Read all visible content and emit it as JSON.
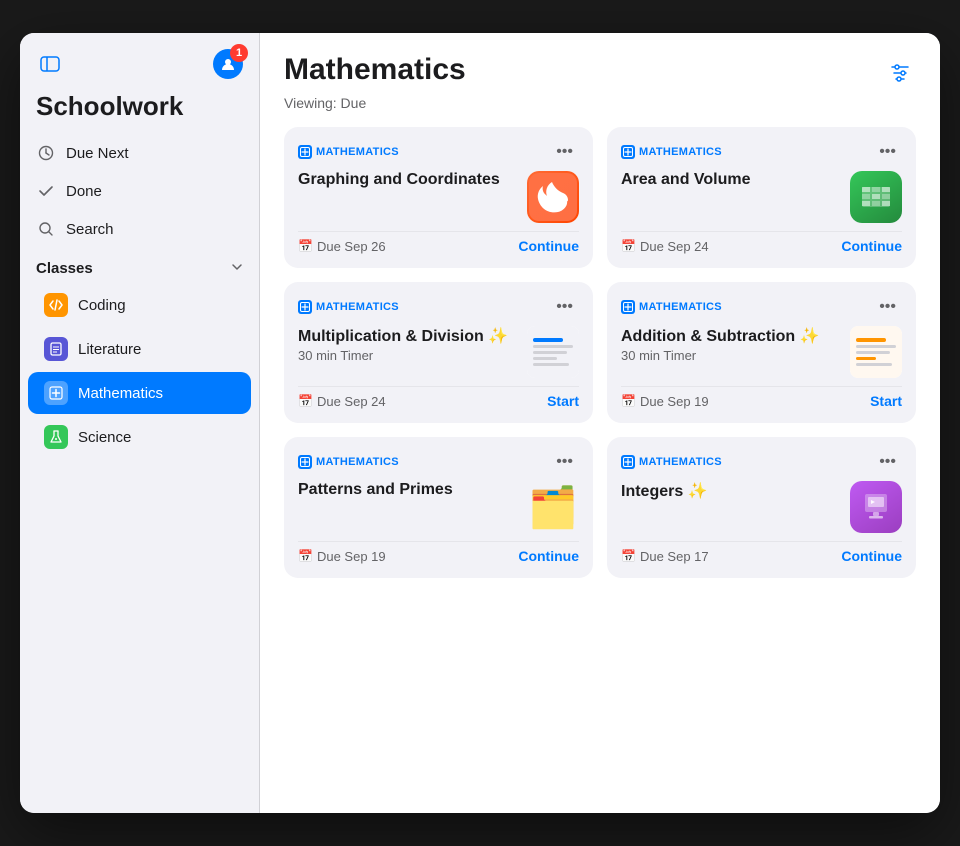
{
  "sidebar": {
    "toggle_label": "⊞",
    "profile_label": "👤",
    "notification_count": "1",
    "app_title": "Schoolwork",
    "nav_items": [
      {
        "id": "due-next",
        "icon": "🕐",
        "label": "Due Next"
      },
      {
        "id": "done",
        "icon": "✓",
        "label": "Done"
      },
      {
        "id": "search",
        "icon": "🔍",
        "label": "Search"
      }
    ],
    "classes_section": {
      "title": "Classes",
      "items": [
        {
          "id": "coding",
          "label": "Coding",
          "color": "coding",
          "icon": "■"
        },
        {
          "id": "literature",
          "label": "Literature",
          "color": "literature",
          "icon": "■"
        },
        {
          "id": "mathematics",
          "label": "Mathematics",
          "color": "mathematics",
          "icon": "■",
          "active": true
        },
        {
          "id": "science",
          "label": "Science",
          "color": "science",
          "icon": "✿"
        }
      ]
    }
  },
  "main": {
    "page_title": "Mathematics",
    "viewing_label": "Viewing: Due",
    "filter_icon": "≡",
    "cards": [
      {
        "id": "graphing",
        "subject": "MATHEMATICS",
        "title": "Graphing and Coordinates",
        "subtitle": "",
        "app_type": "swift",
        "due": "Due Sep 26",
        "action": "Continue"
      },
      {
        "id": "area-volume",
        "subject": "MATHEMATICS",
        "title": "Area and Volume",
        "subtitle": "",
        "app_type": "numbers",
        "due": "Due Sep 24",
        "action": "Continue"
      },
      {
        "id": "multiplication",
        "subject": "MATHEMATICS",
        "title": "Multiplication & Division ✨",
        "subtitle": "30 min Timer",
        "app_type": "thumbnail",
        "due": "Due Sep 24",
        "action": "Start"
      },
      {
        "id": "addition",
        "subject": "MATHEMATICS",
        "title": "Addition & Subtraction ✨",
        "subtitle": "30 min Timer",
        "app_type": "thumbnail2",
        "due": "Due Sep 19",
        "action": "Start"
      },
      {
        "id": "patterns",
        "subject": "MATHEMATICS",
        "title": "Patterns and Primes",
        "subtitle": "",
        "app_type": "folder",
        "due": "Due Sep 19",
        "action": "Continue"
      },
      {
        "id": "integers",
        "subject": "MATHEMATICS",
        "title": "Integers ✨",
        "subtitle": "",
        "app_type": "keynote",
        "due": "Due Sep 17",
        "action": "Continue"
      }
    ],
    "more_label": "•••"
  }
}
